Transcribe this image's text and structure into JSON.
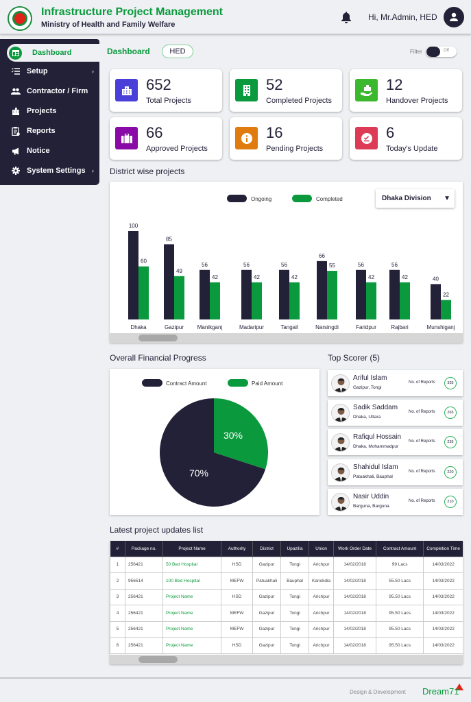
{
  "header": {
    "title": "Infrastructure Project Management",
    "subtitle": "Ministry of Health and Family Welfare",
    "greeting": "Hi, Mr.Admin, HED",
    "logo_icon": "govt-seal-icon",
    "bell_icon": "bell-icon",
    "user_icon": "user-icon"
  },
  "sidebar": {
    "items": [
      {
        "label": "Dashboard",
        "icon": "dashboard-icon",
        "active": true
      },
      {
        "label": "Setup",
        "icon": "checklist-icon",
        "has_submenu": true
      },
      {
        "label": "Contractor / Firm",
        "icon": "group-icon"
      },
      {
        "label": "Projects",
        "icon": "buildings-icon"
      },
      {
        "label": "Reports",
        "icon": "clipboard-icon"
      },
      {
        "label": "Notice",
        "icon": "megaphone-icon"
      },
      {
        "label": "System Settings",
        "icon": "gear-icon",
        "has_submenu": true
      }
    ],
    "chevron": "›"
  },
  "page": {
    "breadcrumb": "Dashboard",
    "org_badge": "HED",
    "filter_label": "Filter",
    "filter_state": "Off"
  },
  "stats": [
    {
      "value": "652",
      "label": "Total Projects",
      "icon": "office-building-icon",
      "color": "#4a3fd8"
    },
    {
      "value": "52",
      "label": "Completed Projects",
      "icon": "building-icon",
      "color": "#0a9a3d"
    },
    {
      "value": "12",
      "label": "Handover Projects",
      "icon": "handover-icon",
      "color": "#3cb82e"
    },
    {
      "value": "66",
      "label": "Approved Projects",
      "icon": "briefcase-icon",
      "color": "#8a0aa8"
    },
    {
      "value": "16",
      "label": "Pending Projects",
      "icon": "info-icon",
      "color": "#e07b0f"
    },
    {
      "value": "6",
      "label": "Today's Update",
      "icon": "check-badge-icon",
      "color": "#dd3a55"
    }
  ],
  "district_section": {
    "title": "District wise projects",
    "division_select": "Dhaka Division",
    "dropdown_arrow": "▼"
  },
  "finance_section": {
    "title": "Overall Financial Progress"
  },
  "chart_data": [
    {
      "type": "bar",
      "title": "District wise projects",
      "categories": [
        "Dhaka",
        "Gazipur",
        "Manikganj",
        "Madaripur",
        "Tangail",
        "Narsingdi",
        "Faridpur",
        "Rajbari",
        "Munshiganj"
      ],
      "series": [
        {
          "name": "Ongoing",
          "color": "#232138",
          "values": [
            100,
            85,
            56,
            56,
            56,
            66,
            56,
            56,
            40
          ]
        },
        {
          "name": "Completed",
          "color": "#0a9a3d",
          "values": [
            60,
            49,
            42,
            42,
            42,
            55,
            42,
            42,
            22
          ]
        }
      ],
      "legend": "top-center",
      "grid": false
    },
    {
      "type": "pie",
      "title": "Overall Financial Progress",
      "labels": [
        "Contract Amount",
        "Paid Amount"
      ],
      "values": [
        70,
        30
      ],
      "colors": [
        "#232138",
        "#0a9a3d"
      ],
      "value_labels": [
        "70%",
        "30%"
      ],
      "legend": "top-center"
    }
  ],
  "top_scorer": {
    "title": "Top Scorer (5)",
    "reports_label": "No. of Reports",
    "people": [
      {
        "name": "Ariful Islam",
        "location": "Gazipur, Tongi",
        "reports": "335"
      },
      {
        "name": "Sadik Saddam",
        "location": "Dhaka, Uttara",
        "reports": "265"
      },
      {
        "name": "Rafiqul Hossain",
        "location": "Dhaka, Mohammadpur",
        "reports": "235"
      },
      {
        "name": "Shahidul Islam",
        "location": "Patuakhali, Bauphal",
        "reports": "220"
      },
      {
        "name": "Nasir Uddin",
        "location": "Barguna, Barguna",
        "reports": "210"
      }
    ]
  },
  "updates": {
    "title": "Latest project updates list",
    "columns": [
      "#",
      "Package no.",
      "Project Name",
      "Authority",
      "District",
      "Upazilla",
      "Union",
      "Work Order Date",
      "Contract Amount",
      "Completion Time"
    ],
    "rows": [
      [
        "1",
        "256421",
        "50 Bed Hospital",
        "HSD",
        "Gazipur",
        "Tongi",
        "Arichpur",
        "14/02/2018",
        "99 Lacs",
        "14/03/2022"
      ],
      [
        "2",
        "956514",
        "100 Bed Hospital",
        "MEFW",
        "Patuakhali",
        "Bauphal",
        "Kanokdia",
        "14/02/2018",
        "55.50 Lacs",
        "14/03/2022"
      ],
      [
        "3",
        "256421",
        "Project Name",
        "HSD",
        "Gazipur",
        "Tongi",
        "Arichpur",
        "14/02/2018",
        "95.50 Lacs",
        "14/03/2022"
      ],
      [
        "4",
        "256421",
        "Project Name",
        "MEFW",
        "Gazipur",
        "Tongi",
        "Arichpur",
        "14/02/2018",
        "95.50 Lacs",
        "14/03/2022"
      ],
      [
        "5",
        "256421",
        "Project Name",
        "MEFW",
        "Gazipur",
        "Tongi",
        "Arichpur",
        "14/02/2018",
        "95.50 Lacs",
        "14/03/2022"
      ],
      [
        "6",
        "256421",
        "Project Name",
        "HSD",
        "Gazipur",
        "Tongi",
        "Arichpur",
        "14/02/2018",
        "95.50 Lacs",
        "14/03/2022"
      ]
    ]
  },
  "footer": {
    "credit": "Design & Development",
    "brand": "Dream71"
  }
}
